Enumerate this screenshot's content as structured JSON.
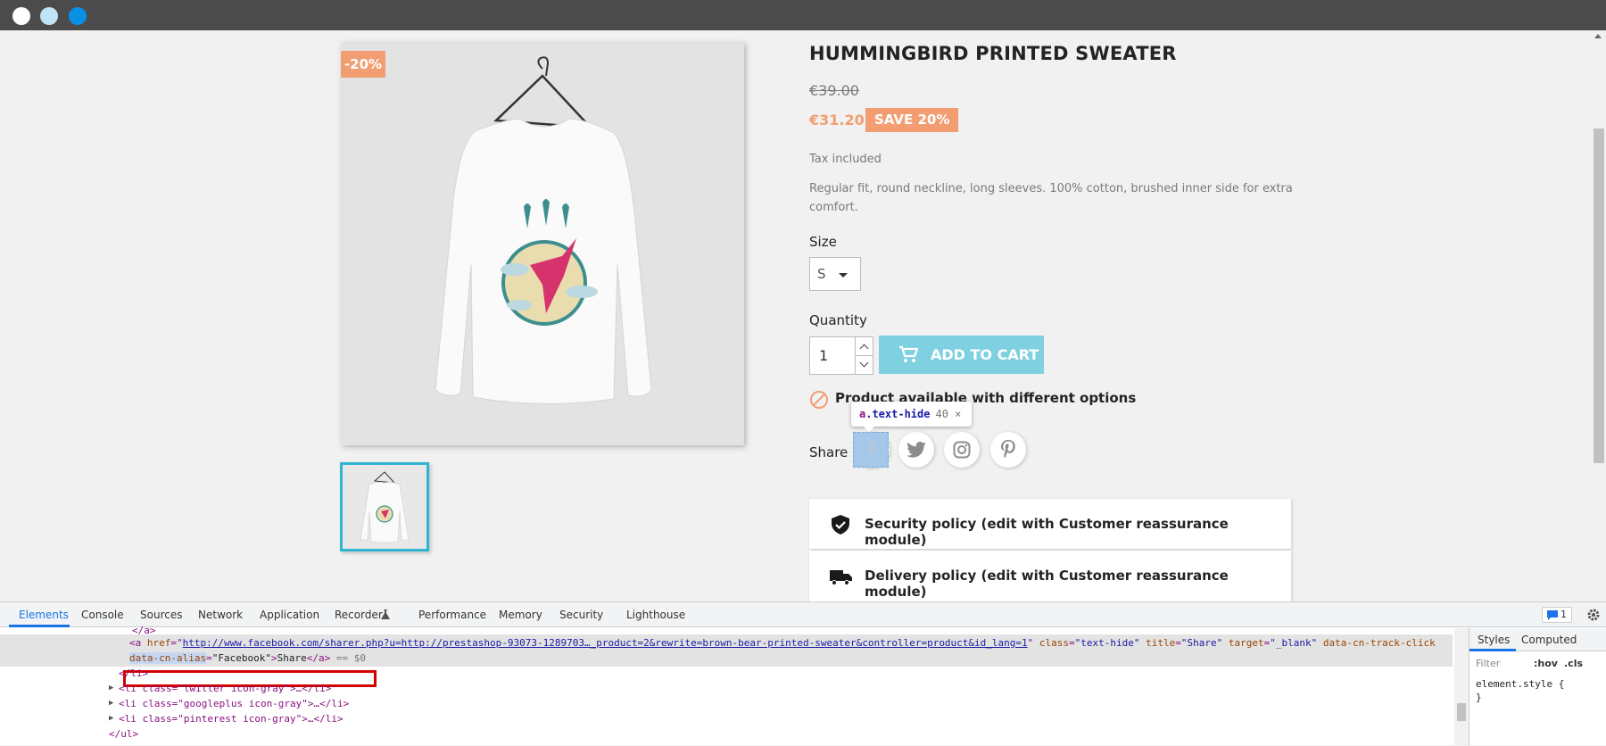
{
  "window": {
    "dot_colors": [
      "#ffffff",
      "#bfe3f7",
      "#0a8fe6"
    ]
  },
  "product": {
    "discount_flag": "-20%",
    "title": "HUMMINGBIRD PRINTED SWEATER",
    "regular_price": "€39.00",
    "price": "€31.20",
    "save_badge": "SAVE 20%",
    "tax_label": "Tax included",
    "description": "Regular fit, round neckline, long sleeves. 100% cotton, brushed inner side for extra comfort.",
    "size_label": "Size",
    "size_value": "S",
    "quantity_label": "Quantity",
    "quantity_value": "1",
    "add_to_cart": "ADD TO CART",
    "availability": "Product available with different options",
    "share_label": "Share",
    "share_networks": [
      "facebook-icon",
      "twitter-icon",
      "instagram-icon",
      "pinterest-icon"
    ]
  },
  "tooltip": {
    "tag": "a",
    "class": ".text-hide",
    "dims": "40 × 40"
  },
  "reassurance": [
    {
      "icon": "shield-check-icon",
      "text": "Security policy (edit with Customer reassurance module)"
    },
    {
      "icon": "truck-icon",
      "text": "Delivery policy (edit with Customer reassurance module)"
    }
  ],
  "devtools": {
    "tabs": [
      "Elements",
      "Console",
      "Sources",
      "Network",
      "Application",
      "Recorder",
      "Performance",
      "Memory",
      "Security",
      "Lighthouse"
    ],
    "active_tab": "Elements",
    "issues_count": "1",
    "code": {
      "line0": "</a>",
      "href_attr": "href",
      "href_val": "http://www.facebook.com/sharer.php?u=http://prestashop-93073-1289703…_product=2&rewrite=brown-bear-printed-sweater&controller=product&id_lang=1",
      "class_attr": "class",
      "class_val": "\"text-hide\"",
      "title_attr": "title",
      "title_val": "\"Share\"",
      "target_attr": "target",
      "target_val": "\"_blank\"",
      "track_attr": "data-cn-track-click",
      "alias_attr": "data-cn-alias",
      "alias_val": "\"Facebook\"",
      "link_text": "Share",
      "dollar": "== $0",
      "li_close": "</li>",
      "li_twitter": "<li class=\"twitter icon-gray\">…</li>",
      "li_google": "<li class=\"googleplus icon-gray\">…</li>",
      "li_pinterest": "<li class=\"pinterest icon-gray\">…</li>",
      "ul_close": "</ul>"
    },
    "styles": {
      "tabs": [
        "Styles",
        "Computed"
      ],
      "filter_placeholder": "Filter",
      "hov": ":hov",
      "cls": ".cls",
      "rule": "element.style {",
      "rule_close": "}"
    }
  }
}
